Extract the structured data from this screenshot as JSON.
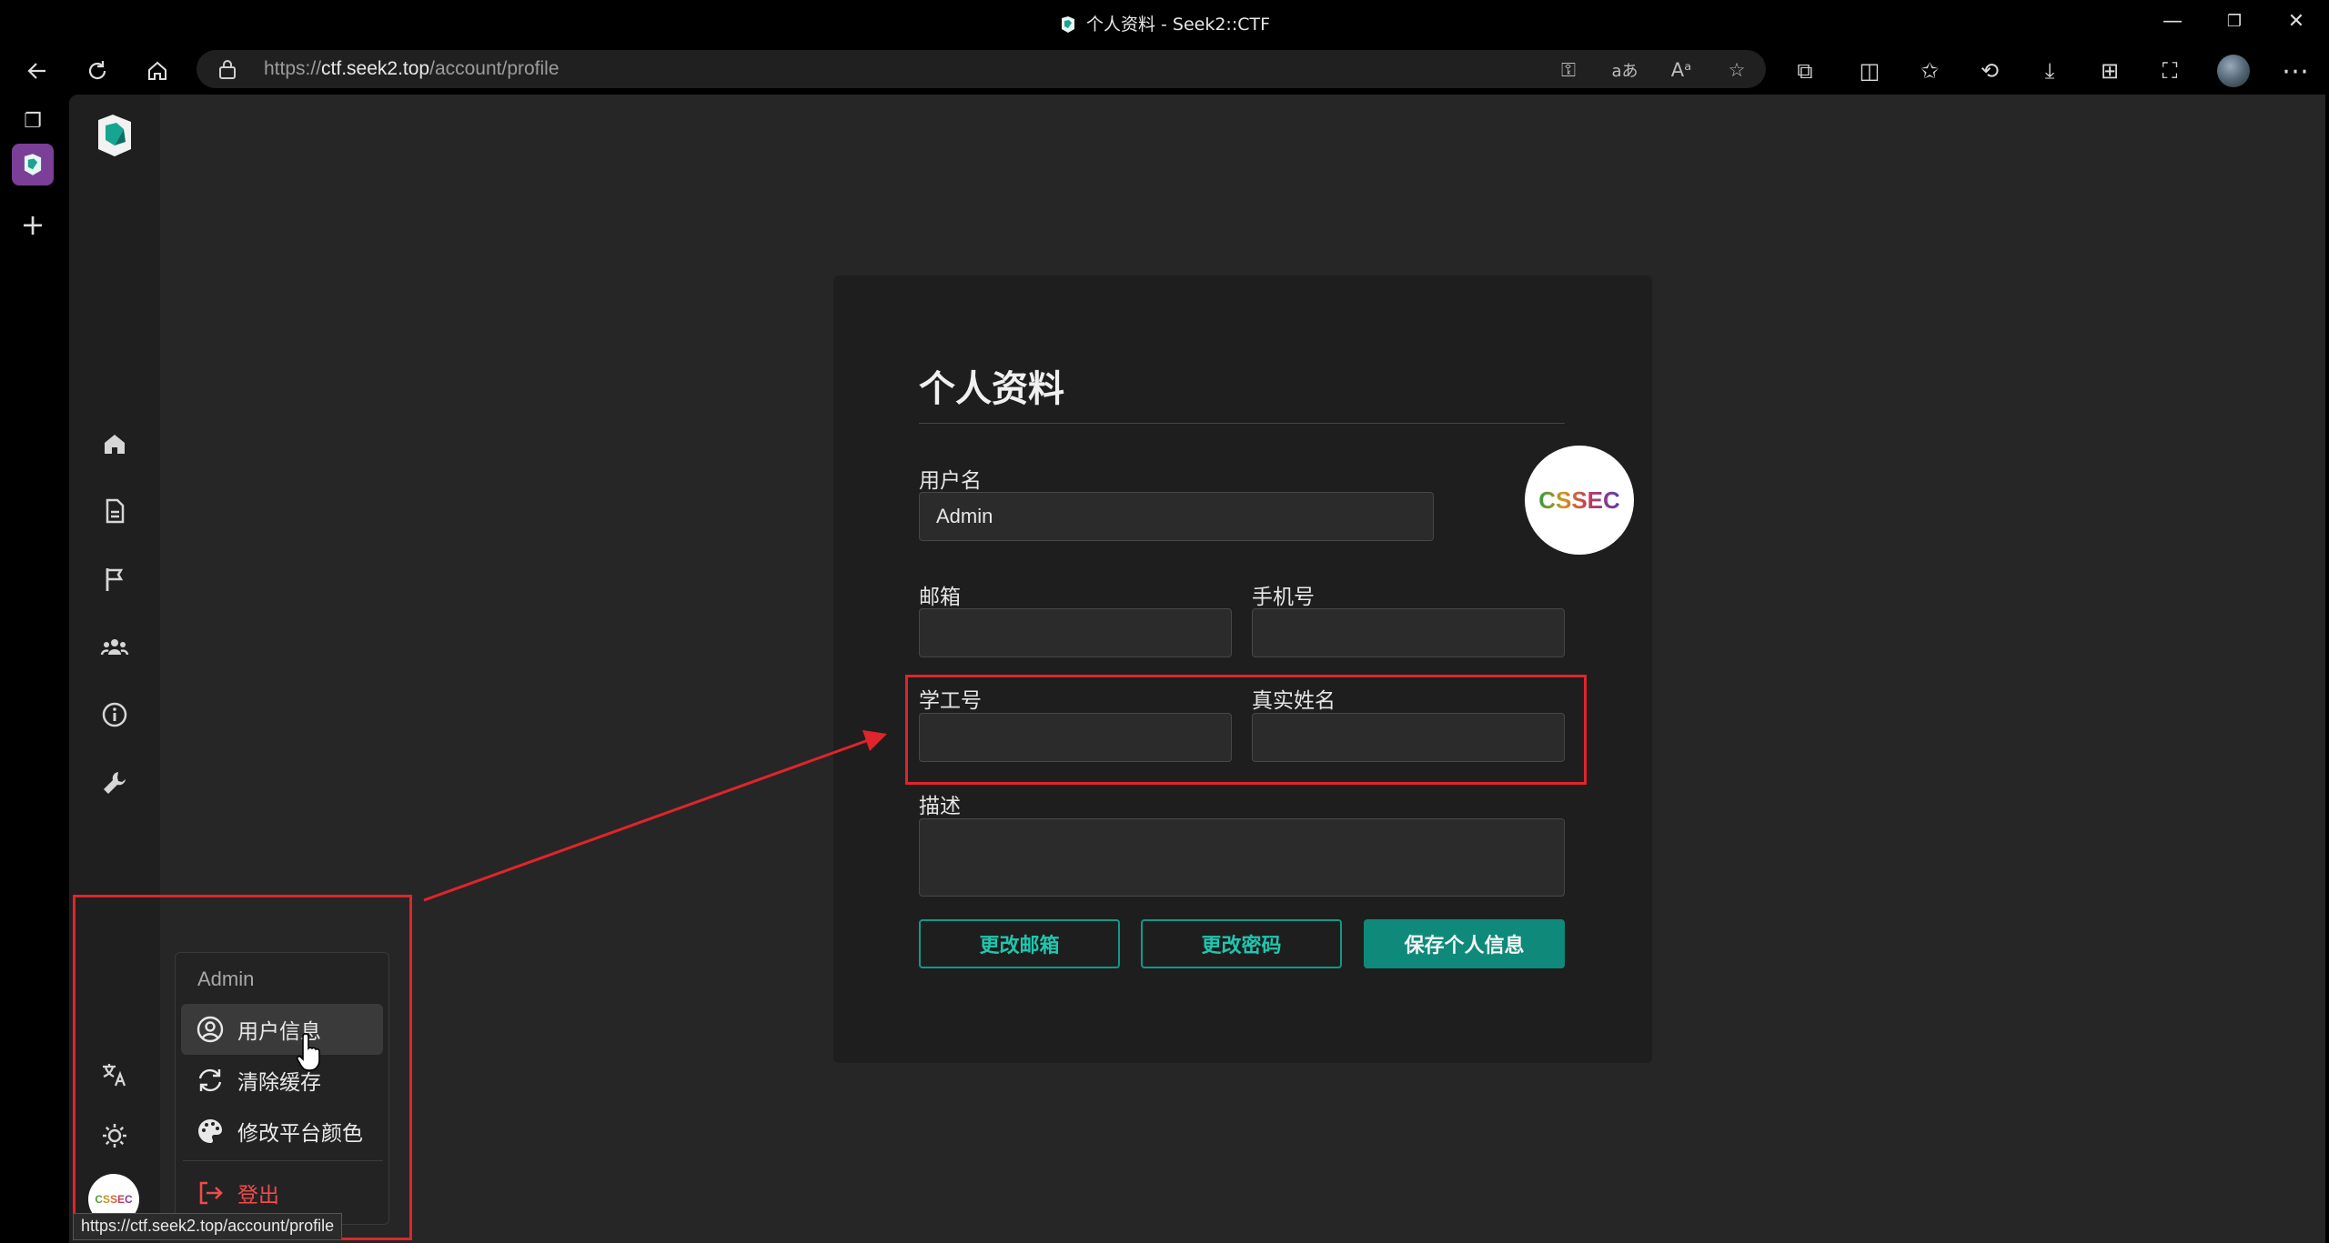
{
  "window": {
    "title": "个人资料 - Seek2::CTF",
    "controls": [
      "minimize-icon",
      "restore-icon",
      "close-icon"
    ]
  },
  "toolbar": {
    "url_prefix": "https://",
    "url_host": "ctf.seek2.top",
    "url_path": "/account/profile",
    "icons": [
      "back-icon",
      "refresh-icon",
      "home-icon",
      "key-icon",
      "translate-icon",
      "read-aloud-icon",
      "favorite-star-icon",
      "extensions-icon",
      "split-screen-icon",
      "favorites-icon",
      "history-icon",
      "downloads-icon",
      "collections-icon",
      "screenshot-icon",
      "profile-avatar",
      "more-menu-icon"
    ]
  },
  "sidebar": {
    "icons": [
      "home-icon",
      "document-icon",
      "flag-icon",
      "users-icon",
      "info-icon",
      "wrench-icon",
      "translate-icon",
      "theme-icon"
    ]
  },
  "profile": {
    "heading": "个人资料",
    "avatar_text": "CSSEC",
    "username_label": "用户名",
    "username_value": "Admin",
    "email_label": "邮箱",
    "email_value": "",
    "phone_label": "手机号",
    "phone_value": "",
    "student_id_label": "学工号",
    "student_id_value": "",
    "realname_label": "真实姓名",
    "realname_value": "",
    "description_label": "描述",
    "description_value": "",
    "change_email": "更改邮箱",
    "change_password": "更改密码",
    "save_profile": "保存个人信息"
  },
  "menu": {
    "header": "Admin",
    "items": [
      {
        "label": "用户信息",
        "icon": "user-circle-icon"
      },
      {
        "label": "清除缓存",
        "icon": "sync-icon"
      },
      {
        "label": "修改平台颜色",
        "icon": "palette-icon"
      }
    ],
    "logout": "登出"
  },
  "user_avatar_text": "CSSEC",
  "status_url": "https://ctf.seek2.top/account/profile",
  "colors": {
    "accent": "#0f8a7a",
    "accent_text": "#1ec7ae",
    "annotation_red": "#e0242c",
    "danger": "#ef4b4b"
  }
}
